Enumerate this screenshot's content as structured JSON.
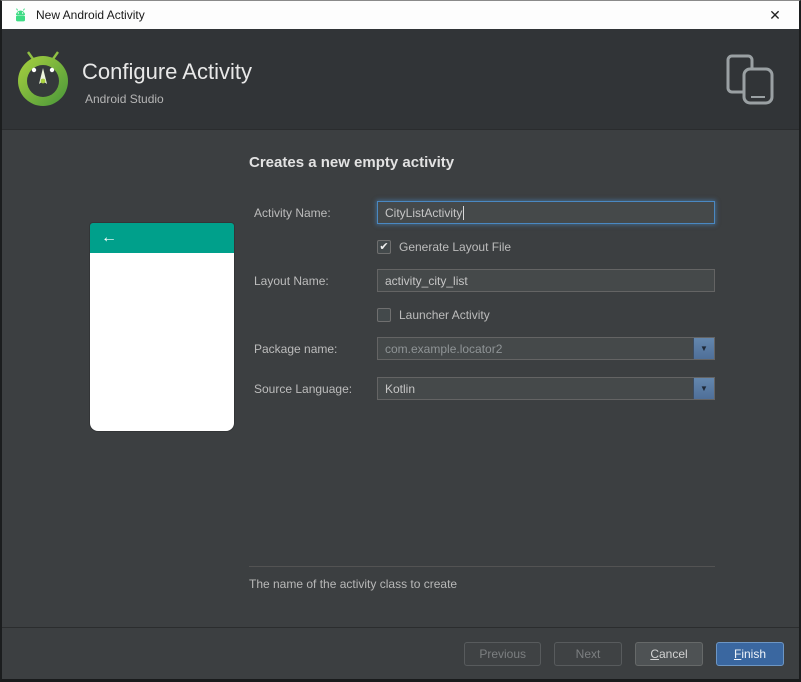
{
  "window": {
    "title": "New Android Activity"
  },
  "icons": {
    "close": "✕",
    "back_arrow": "←",
    "check": "✔",
    "dropdown_arrow": "▼"
  },
  "header": {
    "title": "Configure Activity",
    "subtitle": "Android Studio"
  },
  "main": {
    "heading": "Creates a new empty activity",
    "fields": {
      "activity_name": {
        "label": "Activity Name:",
        "value": "CityListActivity"
      },
      "generate_layout_file": {
        "label": "Generate Layout File",
        "checked": true
      },
      "layout_name": {
        "label": "Layout Name:",
        "value": "activity_city_list"
      },
      "launcher_activity": {
        "label": "Launcher Activity",
        "checked": false
      },
      "package_name": {
        "label": "Package name:",
        "value": "com.example.locator2"
      },
      "source_language": {
        "label": "Source Language:",
        "value": "Kotlin"
      }
    },
    "hint": "The name of the activity class to create"
  },
  "footer": {
    "previous": "Previous",
    "next": "Next",
    "cancel": {
      "mnemonic": "C",
      "rest": "ancel"
    },
    "finish": {
      "mnemonic": "F",
      "rest": "inish"
    }
  },
  "colors": {
    "teal": "#00a08b",
    "accent": "#3a67a0",
    "focus": "#4a88c2"
  }
}
